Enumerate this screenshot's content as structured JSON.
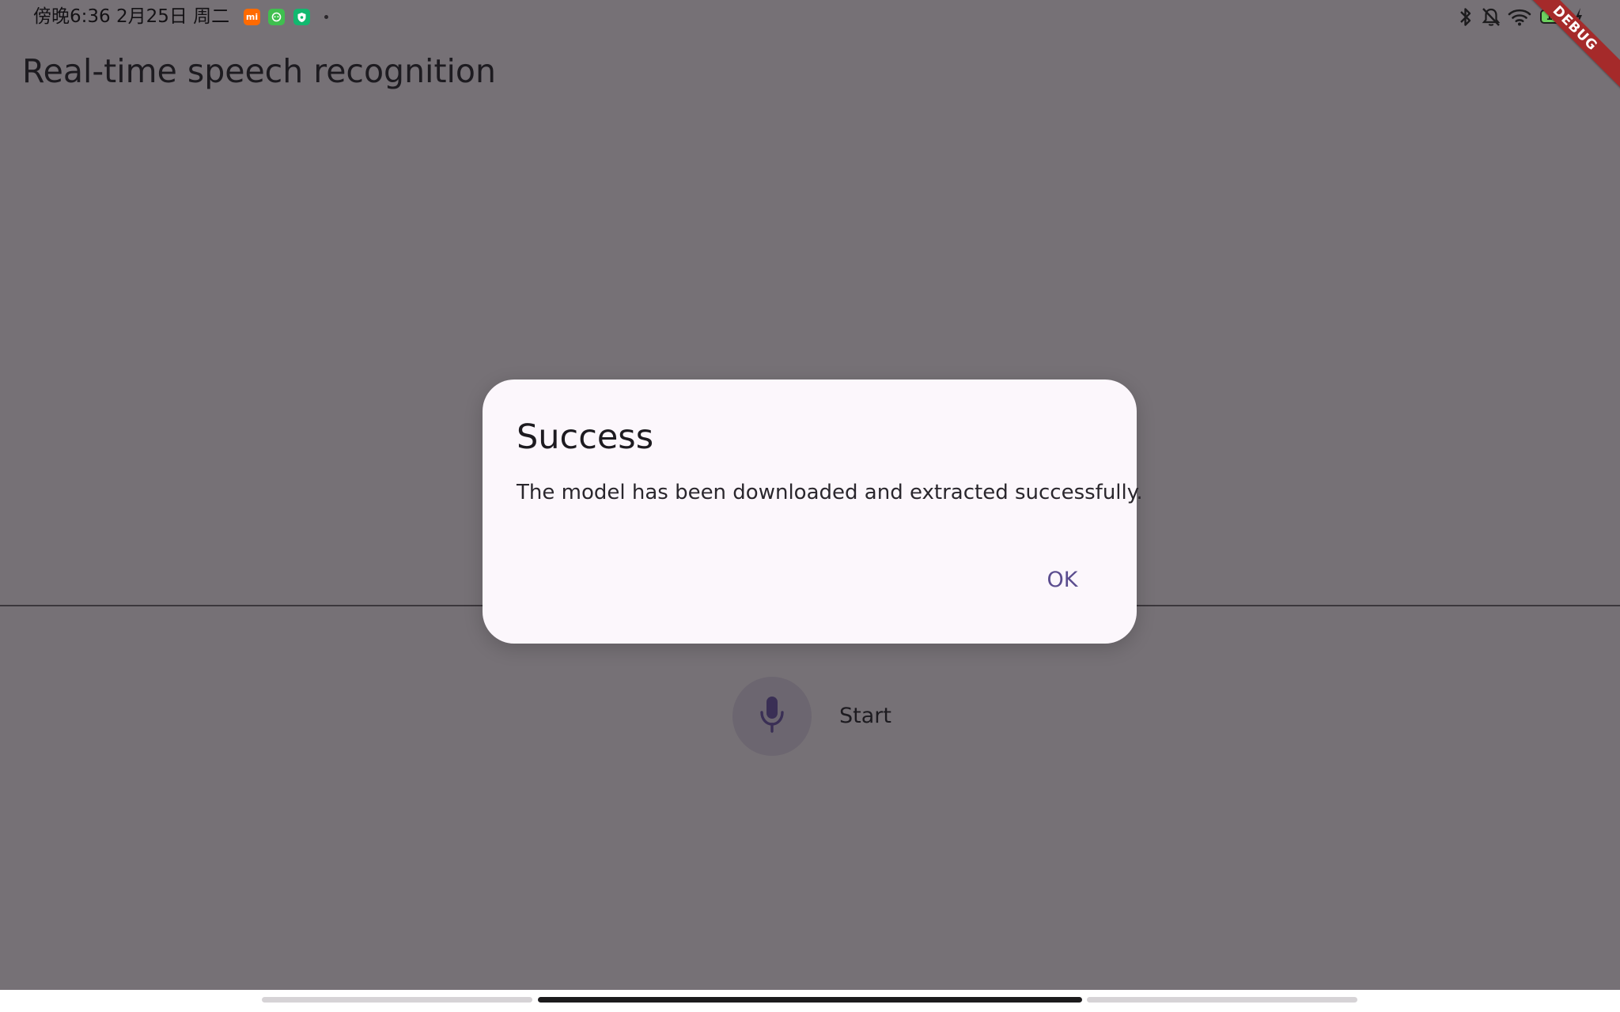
{
  "status_bar": {
    "time_text": "傍晚6:36 2月25日 周二",
    "notification_icons": [
      "mi-app-icon",
      "chat-app-icon",
      "shield-app-icon"
    ],
    "system_icons": [
      "bluetooth-icon",
      "notifications-muted-icon",
      "wifi-icon",
      "battery-icon"
    ],
    "battery_level": "100",
    "colors": {
      "mi": "#ff6a00",
      "chat": "#3fbf4f",
      "shield": "#11b86f"
    }
  },
  "debug_banner": {
    "label": "DEBUG"
  },
  "app_bar": {
    "title": "Real-time speech recognition"
  },
  "main": {
    "mic_icon": "microphone-icon",
    "start_label": "Start"
  },
  "dialog": {
    "title": "Success",
    "message": "The model has been downloaded and extracted successfully.",
    "ok_label": "OK"
  },
  "colors": {
    "scrim_background": "#767176",
    "dialog_surface": "#fcf7fc",
    "accent": "#5b4d8f",
    "debug_banner": "#a52a2a"
  }
}
